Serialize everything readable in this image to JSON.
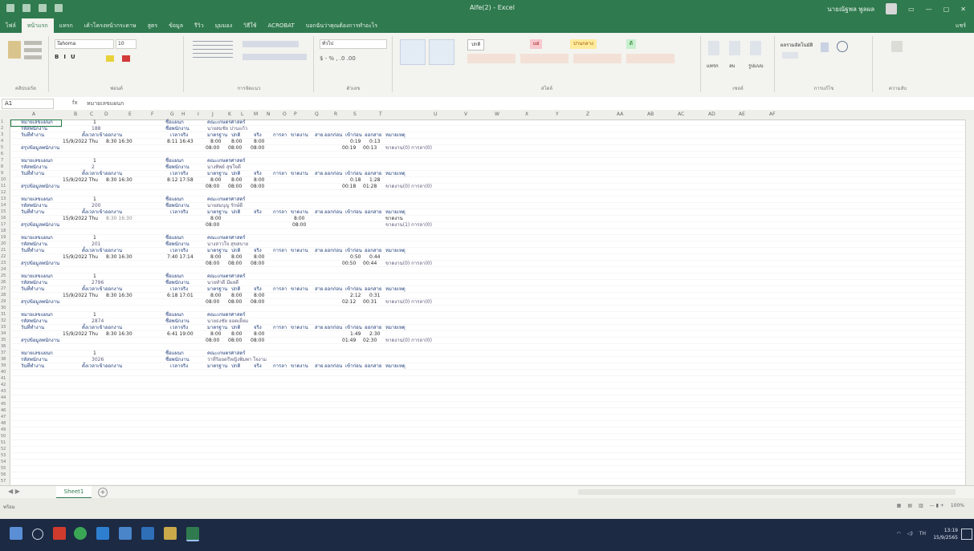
{
  "window": {
    "title": "Alfe(2) - Excel",
    "user": "นายณัฐพล พูลผล"
  },
  "ribbon_tabs": [
    "ไฟล์",
    "หน้าแรก",
    "แทรก",
    "เค้าโครงหน้ากระดาษ",
    "สูตร",
    "ข้อมูล",
    "รีวิว",
    "มุมมอง",
    "วิธีใช้",
    "ACROBAT",
    "บอกฉันว่าคุณต้องการทำอะไร"
  ],
  "share_label": "แชร์",
  "ribbon": {
    "font_name": "Tahoma",
    "font_size": "10",
    "number_format": "ทั่วไป",
    "style_normal": "ปกติ",
    "style_bad": "แย่",
    "style_neutral": "ปานกลาง",
    "style_good": "ดี",
    "groups": [
      "คลิปบอร์ด",
      "ฟอนต์",
      "การจัดแนว",
      "ตัวเลข",
      "สไตล์",
      "เซลล์",
      "การแก้ไข",
      "ความลับ"
    ],
    "insert_label": "แทรก",
    "delete_label": "ลบ",
    "format_label": "รูปแบบ",
    "autosum_label": "ผลรวมอัตโนมัติ"
  },
  "formula_bar": {
    "cell_ref": "A1",
    "fx": "fx",
    "content": "หมายเลขแผนก"
  },
  "columns": [
    "A",
    "B",
    "C",
    "D",
    "E",
    "F",
    "G",
    "H",
    "I",
    "J",
    "K",
    "L",
    "M",
    "N",
    "O",
    "P",
    "Q",
    "R",
    "S",
    "T",
    "U",
    "V",
    "W",
    "X",
    "Y",
    "Z",
    "AA",
    "AB",
    "AC",
    "AD",
    "AE",
    "AF"
  ],
  "labels": {
    "dept_no": "หมายเลขแผนก",
    "emp_code": "รหัสพนักงาน",
    "workday": "วันที่ทำงาน",
    "shift": "ตั้งเวลาเข้าออกงาน",
    "actual": "เวลาจริง",
    "dept_name": "ชื่อแผนก",
    "emp_name": "ชื่อพนักงาน",
    "standard": "มาตรฐาน",
    "normal": "ปกติ",
    "real": "จริง",
    "leave": "การลา",
    "absent": "ขาดงาน",
    "late": "สาย",
    "early": "ออกก่อน",
    "in_early": "เข้าก่อน",
    "out_late": "ออกสาย",
    "note": "หมายเหตุ",
    "summary": "สรุปข้อมูลพนักงาน"
  },
  "records": [
    {
      "dept": "1",
      "code": "188",
      "dept_name": "คณะเกษตรศาสตร์",
      "name": "นายสมชัย ปานแก้ว",
      "date": "15/9/2022 Thu",
      "shift": "8:30 16:30",
      "actual": "8:11 16:43",
      "std": [
        "8:00",
        "8:00",
        "8:00"
      ],
      "in_early": "0:19",
      "out_late": "0:13",
      "sum": [
        "08:00",
        "08:00",
        "08:00"
      ],
      "sum_r": "00:19",
      "sum_s": "00:13",
      "note": "ขาดงาน(0) การลา(0)"
    },
    {
      "dept": "1",
      "code": "2",
      "dept_name": "คณะเกษตรศาสตร์",
      "name": "นางทิพย์ สุขใจดี",
      "date": "15/9/2022 Thu",
      "shift": "8:30 16:30",
      "actual": "8:12 17:58",
      "std": [
        "8:00",
        "8:00",
        "8:00"
      ],
      "in_early": "0:18",
      "out_late": "1:28",
      "sum": [
        "08:00",
        "08:00",
        "08:00"
      ],
      "sum_r": "00:18",
      "sum_s": "01:28",
      "note": "ขาดงาน(0) การลา(0)"
    },
    {
      "dept": "1",
      "code": "200",
      "dept_name": "คณะเกษตรศาสตร์",
      "name": "นายสมบุญ รักษ์ดี",
      "date": "15/9/2022 Thu",
      "shift": "8:30 16:30",
      "actual": "",
      "std": [
        "8:00",
        "",
        ""
      ],
      "absent": "8:00",
      "note_line": "ขาดงาน",
      "sum": [
        "08:00",
        "",
        ""
      ],
      "sum_absent": "08:00",
      "sum_r": "",
      "sum_s": "",
      "note": "ขาดงาน(1) การลา(0)"
    },
    {
      "dept": "1",
      "code": "201",
      "dept_name": "คณะเกษตรศาสตร์",
      "name": "นางสาวใจ สุขสบาย",
      "date": "15/9/2022 Thu",
      "shift": "8:30 16:30",
      "actual": "7:40 17:14",
      "std": [
        "8:00",
        "8:00",
        "8:00"
      ],
      "in_early": "0:50",
      "out_late": "0:44",
      "sum": [
        "08:00",
        "08:00",
        "08:00"
      ],
      "sum_r": "00:50",
      "sum_s": "00:44",
      "note": "ขาดงาน(0) การลา(0)"
    },
    {
      "dept": "1",
      "code": "2796",
      "dept_name": "คณะเกษตรศาสตร์",
      "name": "นายทำดี มีผลดี",
      "date": "15/9/2022 Thu",
      "shift": "8:30 16:30",
      "actual": "6:18 17:01",
      "std": [
        "8:00",
        "8:00",
        "8:00"
      ],
      "in_early": "2:12",
      "out_late": "0:31",
      "sum": [
        "08:00",
        "08:00",
        "08:00"
      ],
      "sum_r": "02:12",
      "sum_s": "00:31",
      "note": "ขาดงาน(0) การลา(0)"
    },
    {
      "dept": "1",
      "code": "2874",
      "dept_name": "คณะเกษตรศาสตร์",
      "name": "นายธงชัย ยอดเยี่ยม",
      "date": "15/9/2022 Thu",
      "shift": "8:30 16:30",
      "actual": "6:41 19:00",
      "std": [
        "8:00",
        "8:00",
        "8:00"
      ],
      "in_early": "1:49",
      "out_late": "2:30",
      "sum": [
        "08:00",
        "08:00",
        "08:00"
      ],
      "sum_r": "01:49",
      "sum_s": "02:30",
      "note": "ขาดงาน(0) การลา(0)"
    },
    {
      "dept": "1",
      "code": "3026",
      "dept_name": "คณะเกษตรศาสตร์",
      "name": "ว่าที่ร้อยตรีหญิงพิมพา ใจงาม",
      "partial": true
    }
  ],
  "sheet_tab": "Sheet1",
  "status": {
    "ready": "พร้อม",
    "zoom": "100%"
  },
  "clock": {
    "time": "13:19",
    "date": "15/9/2565"
  },
  "colors": {
    "excel_green": "#2f7a4e",
    "label_blue": "#1f3d7a",
    "taskbar": "#1c2a44"
  }
}
